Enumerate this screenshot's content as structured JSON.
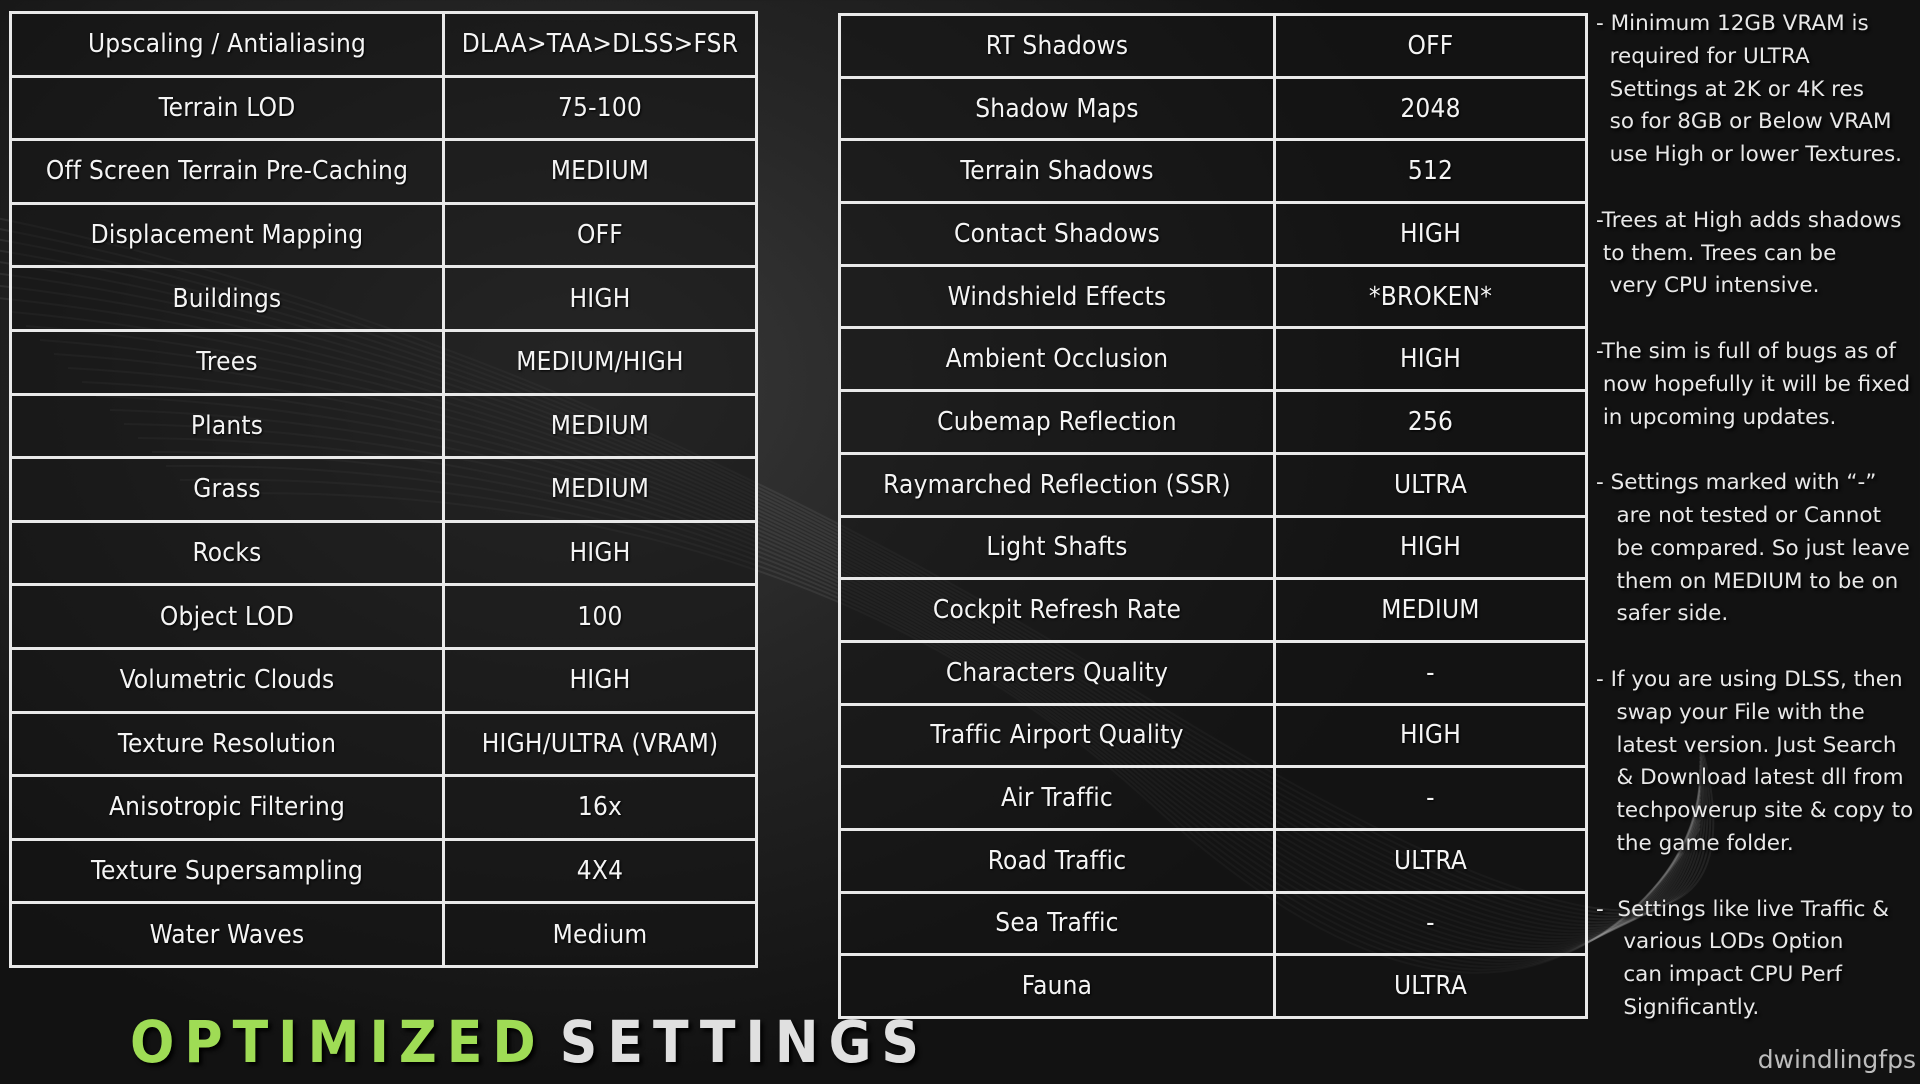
{
  "left_table": {
    "rows": [
      {
        "setting": "Upscaling / Antialiasing",
        "value": "DLAA>TAA>DLSS>FSR"
      },
      {
        "setting": "Terrain LOD",
        "value": "75-100"
      },
      {
        "setting": "Off Screen Terrain Pre-Caching",
        "value": "MEDIUM"
      },
      {
        "setting": "Displacement Mapping",
        "value": "OFF"
      },
      {
        "setting": "Buildings",
        "value": "HIGH"
      },
      {
        "setting": "Trees",
        "value": "MEDIUM/HIGH"
      },
      {
        "setting": "Plants",
        "value": "MEDIUM"
      },
      {
        "setting": "Grass",
        "value": "MEDIUM"
      },
      {
        "setting": "Rocks",
        "value": "HIGH"
      },
      {
        "setting": "Object LOD",
        "value": "100"
      },
      {
        "setting": "Volumetric Clouds",
        "value": "HIGH"
      },
      {
        "setting": "Texture Resolution",
        "value": "HIGH/ULTRA (VRAM)"
      },
      {
        "setting": "Anisotropic Filtering",
        "value": "16x"
      },
      {
        "setting": "Texture Supersampling",
        "value": "4X4"
      },
      {
        "setting": "Water Waves",
        "value": "Medium"
      }
    ]
  },
  "right_table": {
    "rows": [
      {
        "setting": "RT Shadows",
        "value": "OFF"
      },
      {
        "setting": "Shadow Maps",
        "value": "2048"
      },
      {
        "setting": "Terrain Shadows",
        "value": "512"
      },
      {
        "setting": "Contact Shadows",
        "value": "HIGH"
      },
      {
        "setting": "Windshield Effects",
        "value": "*BROKEN*"
      },
      {
        "setting": "Ambient Occlusion",
        "value": "HIGH"
      },
      {
        "setting": "Cubemap Reflection",
        "value": "256"
      },
      {
        "setting": "Raymarched Reflection (SSR)",
        "value": "ULTRA"
      },
      {
        "setting": "Light Shafts",
        "value": "HIGH"
      },
      {
        "setting": "Cockpit Refresh Rate",
        "value": "MEDIUM"
      },
      {
        "setting": "Characters Quality",
        "value": "-"
      },
      {
        "setting": "Traffic Airport Quality",
        "value": "HIGH"
      },
      {
        "setting": "Air Traffic",
        "value": "-"
      },
      {
        "setting": "Road Traffic",
        "value": "ULTRA"
      },
      {
        "setting": "Sea Traffic",
        "value": "-"
      },
      {
        "setting": "Fauna",
        "value": "ULTRA"
      }
    ]
  },
  "title": {
    "part1": "OPTIMIZED",
    "part2": "SETTINGS",
    "accent_color": "#9fdc55"
  },
  "notes": [
    "- Minimum 12GB VRAM is\n  required for ULTRA\n  Settings at 2K or 4K res\n  so for 8GB or Below VRAM\n  use High or lower Textures.",
    "-Trees at High adds shadows\n to them. Trees can be\n  very CPU intensive.",
    "-The sim is full of bugs as of\n now hopefully it will be fixed\n in upcoming updates.",
    "- Settings marked with “-”\n   are not tested or Cannot\n   be compared. So just leave\n   them on MEDIUM to be on\n   safer side.",
    "- If you are using DLSS, then\n   swap your File with the\n   latest version. Just Search\n   & Download latest dll from\n   techpowerup site & copy to\n   the game folder.",
    "-  Settings like live Traffic &\n    various LODs Option\n    can impact CPU Perf\n    Significantly."
  ],
  "watermark": "dwindlingfps"
}
